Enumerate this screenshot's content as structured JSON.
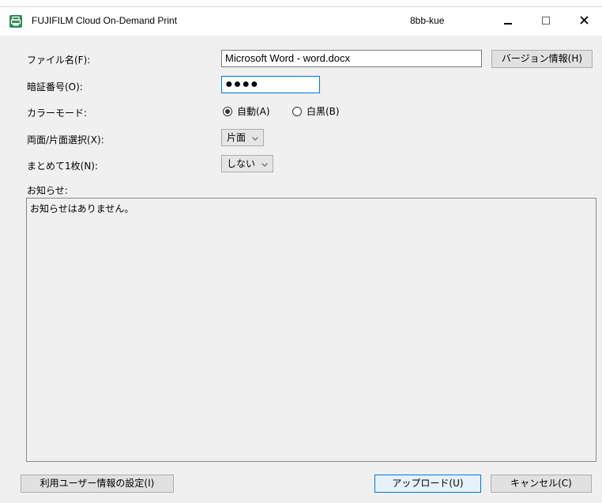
{
  "window": {
    "title": "FUJIFILM Cloud On-Demand Print",
    "user": "8bb-kue",
    "controls": {
      "minimize": "–",
      "maximize": "□",
      "close": "✕"
    }
  },
  "form": {
    "file_name_label": "ファイル名(F):",
    "file_name_value": "Microsoft Word - word.docx",
    "version_button": "バージョン情報(H)",
    "pin_label": "暗証番号(O):",
    "pin_value": "●●●●",
    "color_mode_label": "カラーモード:",
    "color_auto": "自動(A)",
    "color_mono": "白黒(B)",
    "color_selected": "auto",
    "duplex_label": "両面/片面選択(X):",
    "duplex_value": "片面",
    "nup_label": "まとめて1枚(N):",
    "nup_value": "しない",
    "notice_label": "お知らせ:",
    "notice_text": "お知らせはありません。"
  },
  "footer": {
    "user_settings_button": "利用ユーザー情報の設定(I)",
    "upload_button": "アップロード(U)",
    "cancel_button": "キャンセル(C)"
  },
  "colors": {
    "accent": "#0078d7",
    "app_icon": "#2e8b57",
    "window_bg": "#f0f0f0"
  },
  "icons": {
    "app": "printer-icon",
    "dropdown": "chevron-down-icon"
  }
}
